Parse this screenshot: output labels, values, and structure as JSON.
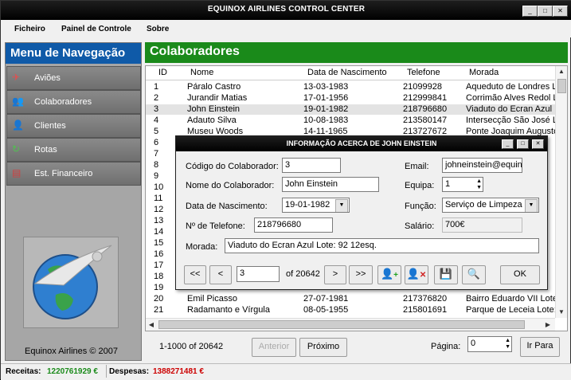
{
  "window": {
    "title": "EQUINOX AIRLINES CONTROL CENTER",
    "controls": [
      "_",
      "□",
      "✕"
    ]
  },
  "menu": [
    "Ficheiro",
    "Painel de Controle",
    "Sobre"
  ],
  "sidebar": {
    "title": "Menu de Navegação",
    "items": [
      {
        "label": "Aviões",
        "icon": "plane-icon"
      },
      {
        "label": "Colaboradores",
        "icon": "people-icon"
      },
      {
        "label": "Clientes",
        "icon": "clients-icon"
      },
      {
        "label": "Rotas",
        "icon": "routes-icon"
      },
      {
        "label": "Est. Financeiro",
        "icon": "finance-icon"
      }
    ],
    "copyright": "Equinox Airlines © 2007"
  },
  "content": {
    "title": "Colaboradores",
    "columns": [
      "ID",
      "Nome",
      "Data de Nascimento",
      "Telefone",
      "Morada"
    ],
    "rows_top": [
      [
        "1",
        "Páralo Castro",
        "13-03-1983",
        "21099928",
        "Aqueduto de Londres L"
      ],
      [
        "2",
        "Jurandir Matias",
        "17-01-1956",
        "212999841",
        "Corrimão Alves Redol L"
      ],
      [
        "3",
        "John Einstein",
        "19-01-1982",
        "218796680",
        "Viaduto do Ecran Azul"
      ],
      [
        "4",
        "Adauto Silva",
        "10-08-1983",
        "213580147",
        "Intersecção São José L"
      ],
      [
        "5",
        "Museu Woods",
        "14-11-1965",
        "213727672",
        "Ponte Joaquim Augusto"
      ]
    ],
    "hidden_ids": [
      "6",
      "7",
      "8",
      "9",
      "10",
      "11",
      "12",
      "13",
      "14",
      "15",
      "16",
      "17",
      "18",
      "19"
    ],
    "rows_bottom": [
      [
        "20",
        "Emil Picasso",
        "27-07-1981",
        "217376820",
        "Bairro Eduardo VII Lote"
      ],
      [
        "21",
        "Radamanto e Vírgula",
        "08-05-1955",
        "215801691",
        "Parque de Leceia Lote:"
      ]
    ],
    "pagination": {
      "range": "1-1000 of 20642",
      "prev": "Anterior",
      "next": "Próximo",
      "page_label": "Página:",
      "page_value": "0",
      "go": "Ir Para"
    }
  },
  "status": {
    "receitas_label": "Receitas:",
    "receitas": "1220761929 €",
    "despesas_label": "Despesas:",
    "despesas": "1388271481 €"
  },
  "dialog": {
    "title": "INFORMAÇÃO ACERCA DE JOHN EINSTEIN",
    "codigo_label": "Código do Colaborador:",
    "codigo": "3",
    "nome_label": "Nome do Colaborador:",
    "nome": "John Einstein",
    "nasc_label": "Data de Nascimento:",
    "nasc": "19-01-1982",
    "tel_label": "Nº de Telefone:",
    "tel": "218796680",
    "email_label": "Email:",
    "email": "johneinstein@equinox",
    "equipa_label": "Equipa:",
    "equipa": "1",
    "funcao_label": "Função:",
    "funcao": "Serviço de Limpeza",
    "salario_label": "Salário:",
    "salario": "700€",
    "morada_label": "Morada:",
    "morada": "Viaduto  do Ecran Azul Lote: 92 12esq.",
    "nav": {
      "first": "<<",
      "prev": "<",
      "record": "3",
      "of": "of 20642",
      "next": ">",
      "last": ">>",
      "ok": "OK"
    }
  },
  "colors": {
    "sidebar_header": "#0f5aa8",
    "content_header": "#1a8a1a",
    "receitas": "#1a8a1a",
    "despesas": "#cc0000"
  }
}
